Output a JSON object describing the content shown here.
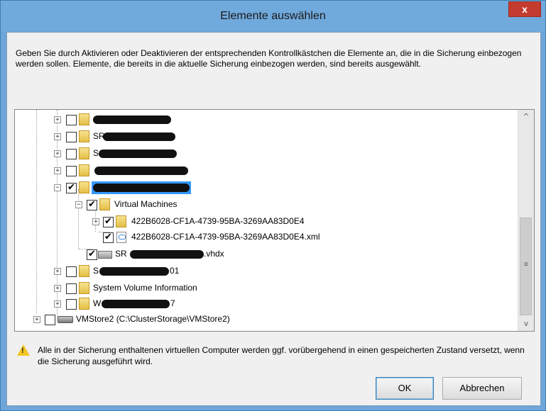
{
  "dialog": {
    "title": "Elemente auswählen",
    "close_label": "x",
    "instructions": "Geben Sie durch Aktivieren oder Deaktivieren der entsprechenden Kontrollkästchen die Elemente an, die in die Sicherung einbezogen werden sollen. Elemente, die bereits in die aktuelle Sicherung einbezogen werden, sind bereits ausgewählt.",
    "warning": "Alle in der Sicherung enthaltenen virtuellen Computer werden ggf. vorübergehend in einen gespeicherten Zustand versetzt, wenn die Sicherung ausgeführt wird.",
    "ok_label": "OK",
    "cancel_label": "Abbrechen"
  },
  "tree": {
    "items": [
      {
        "label": "",
        "expander": "+",
        "checked": "",
        "icon": "folder-icon"
      },
      {
        "label": "SR",
        "label_after": "",
        "expander": "+",
        "checked": "",
        "icon": "folder-icon"
      },
      {
        "label": "S",
        "expander": "+",
        "checked": "",
        "icon": "folder-icon"
      },
      {
        "label": "",
        "expander": "+",
        "checked": "",
        "icon": "folder-icon"
      },
      {
        "label": "",
        "expander": "−",
        "checked": "✔",
        "icon": "folder-icon",
        "selected": true
      },
      {
        "label": "Virtual Machines",
        "expander": "−",
        "checked": "✔",
        "icon": "folder-icon"
      },
      {
        "label": "422B6028-CF1A-4739-95BA-3269AA83D0E4",
        "expander": "+",
        "checked": "✔",
        "icon": "folder-icon"
      },
      {
        "label": "422B6028-CF1A-4739-95BA-3269AA83D0E4.xml",
        "expander": "",
        "checked": "✔",
        "icon": "file-icon"
      },
      {
        "label": "SR",
        "label_after": ".vhdx",
        "expander": "",
        "checked": "✔",
        "icon": "disk-icon"
      },
      {
        "label": "S",
        "label_after": "01",
        "expander": "+",
        "checked": "",
        "icon": "folder-icon"
      },
      {
        "label": "System Volume Information",
        "expander": "+",
        "checked": "",
        "icon": "folder-icon"
      },
      {
        "label": "W",
        "label_after": "7",
        "expander": "+",
        "checked": "",
        "icon": "folder-icon"
      },
      {
        "label": "VMStore2 (C:\\ClusterStorage\\VMStore2)",
        "expander": "+",
        "checked": "",
        "icon": "store-icon"
      }
    ]
  },
  "scrollbar": {
    "up_arrow": "^",
    "down_arrow": "v",
    "grip": "≡"
  },
  "colors": {
    "title_bar": "#70a9dc",
    "close_button": "#c43c2f",
    "selection": "#3399ff",
    "warning_icon": "#f3c623"
  }
}
